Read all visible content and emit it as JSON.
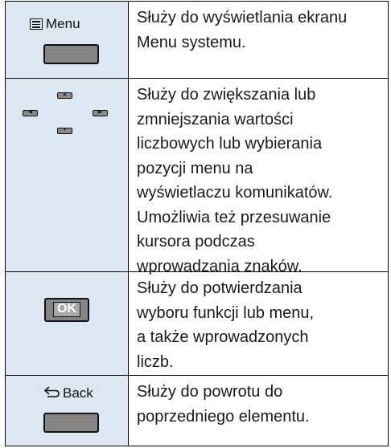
{
  "rows": [
    {
      "key_label": "Menu",
      "key_icon": "menu-list-icon",
      "description_lines": [
        "Służy do wyświetlania ekranu",
        "Menu systemu."
      ]
    },
    {
      "key_icons": [
        "arrow-up-icon",
        "arrow-left-icon",
        "arrow-right-icon",
        "arrow-down-icon"
      ],
      "description_lines": [
        "Służy do zwiększania lub",
        "zmniejszania wartości",
        "liczbowych lub wybierania",
        "pozycji menu na",
        "wyświetlaczu komunikatów.",
        "Umożliwia też przesuwanie",
        "kursora podczas",
        "wprowadzania znaków."
      ]
    },
    {
      "key_label": "OK",
      "description_lines": [
        "Służy do potwierdzania",
        "wyboru funkcji lub menu,",
        "a także wprowadzonych",
        "liczb."
      ]
    },
    {
      "key_label": "Back",
      "key_icon": "back-arrow-icon",
      "description_lines": [
        "Służy do powrotu do",
        "poprzedniego elementu."
      ]
    }
  ],
  "colors": {
    "key_cell_bg": "#dde7f1",
    "key_button": "#858585",
    "border": "#000000"
  }
}
